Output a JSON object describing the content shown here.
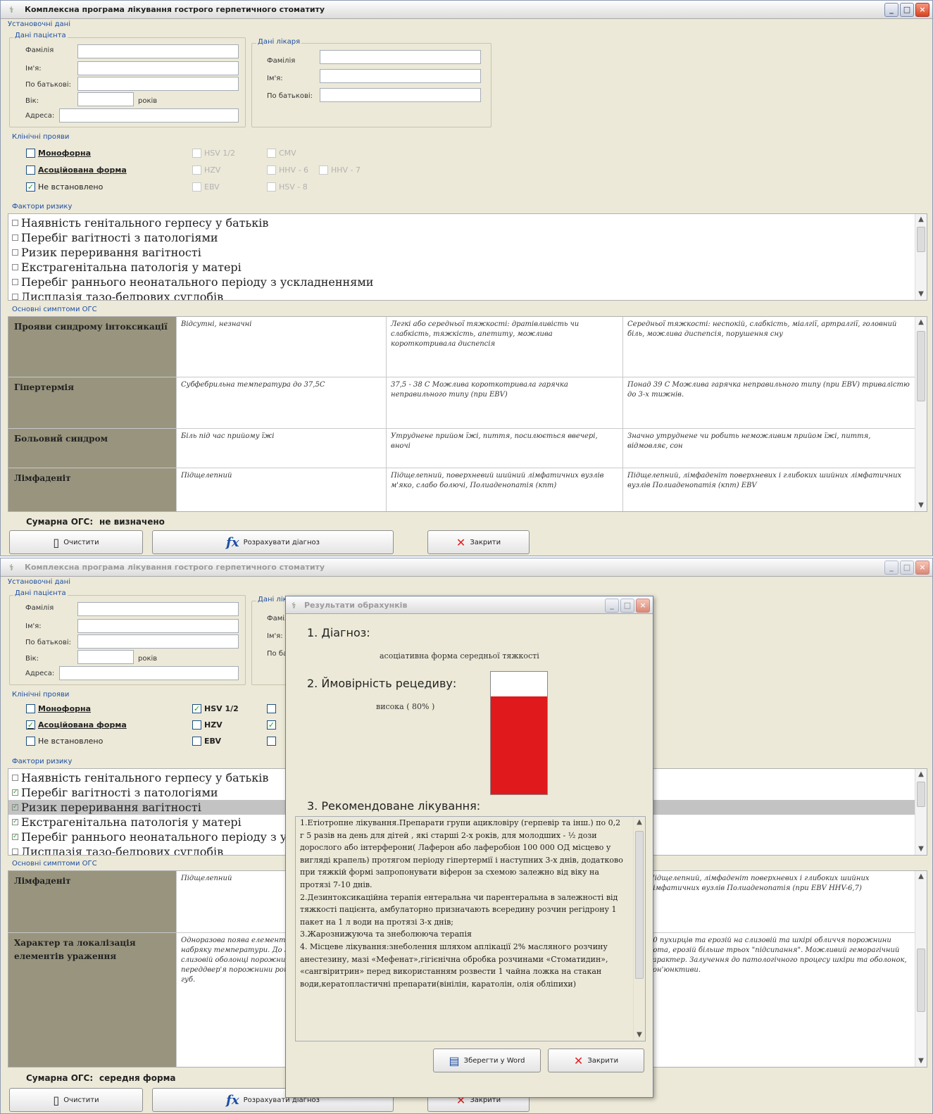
{
  "app": {
    "title": "Комплексна програма лікування гострого герпетичного стоматиту",
    "min_icon": "_",
    "max_icon": "□",
    "close_icon": "×"
  },
  "sections": {
    "settings": "Установочні дані",
    "patient": "Дані пацієнта",
    "doctor": "Дані лікаря",
    "clinical": "Клінічні прояви",
    "risk": "Фактори ризику",
    "symptoms": "Основні симптоми ОГС"
  },
  "labels": {
    "surname": "Фамілія",
    "name": "Ім'я:",
    "patronymic": "По батькові:",
    "age": "Вік:",
    "age_unit": "років",
    "address": "Адреса:",
    "sum": "Сумарна ОГС:"
  },
  "clinical": {
    "mono": "Монофорна",
    "assoc": "Асоційована форма",
    "unset": "Не встановлено",
    "hsv": "HSV 1/2",
    "hzv": "HZV",
    "ebv": "EBV",
    "cmv": "CMV",
    "hhv67": "HHV - 6",
    "hhv7": "HHV - 7",
    "hsv8": "HSV - 8"
  },
  "risk_factors": [
    "Наявність генітального герпесу у батьків",
    "Перебіг вагітності з патологіями",
    "Ризик переривання вагітності",
    "Екстрагенітальна патологія у матері",
    "Перебіг раннього неонатального періоду з ускладненнями",
    "Дисплазія тазо-бедрових суглобів"
  ],
  "screen1": {
    "check_mark": "✓",
    "symptoms": [
      {
        "name": "Прояви синдрому інтоксикації",
        "c1": "Відсутні, незначні",
        "c2": "Легкі або середньої тяжкості: дратівливість чи слабкість, тяжкість, апетиту, можлива короткотривала диспепсія",
        "c3": "Середньої тяжкості: неспокій, слабкість, міалгії, артралгії, головний біль, можлива диспепсія, порушення сну"
      },
      {
        "name": "Гіпертермія",
        "c1": "Субфебрильна температура до 37,5С",
        "c2": "37,5 - 38 С Можлива короткотривала гарячка неправильного типу (при EBV)",
        "c3": "Понад 39 С Можлива гарячка неправильного типу (при EBV) тривалістю до 3-х тижнів."
      },
      {
        "name": "Больовий синдром",
        "c1": "Біль під час прийому їжі",
        "c2": "Утруднене прийом їжі, пиття, посилюється ввечері, вночі",
        "c3": "Значно утруднене чи робить неможливим прийом їжі, пиття, відмовляє, сон"
      },
      {
        "name": "Лімфаденіт",
        "c1": "Підщелепний",
        "c2": "Підщелепний, поверхневий шийний лімфатичних вузлів м'яко, слабо болючі, Полиаденопатія (кпт)",
        "c3": "Підщелепний, лімфаденіт поверхневих і глибоких шийних лімфатичних вузлів Полиаденопатія (кпт) EBV"
      }
    ],
    "sum_value": "не визначено"
  },
  "screen2": {
    "check_mark": "✓",
    "symptoms": [
      {
        "name": "Лімфаденіт",
        "c1": "Підщелепний",
        "c3": "Підщелепний, лімфаденіт поверхневих і глибоких шийних лімфатичних вузлів Полиаденопатія (при EBV HHV-6,7)"
      },
      {
        "name": "Характер та локалізація елементів ураження",
        "c1": "Одноразова поява елементів ураження на фоні набряку температури. До 5 пухирців та ерозій на слизовій оболонці порожнини рота (язика, губ, переддвер'я порожнини рота, щік), червоної кайми губ.",
        "c3": "20 пухирців та ерозій на слизовій та шкірі обличчя порожнини рота, ерозій більше трьох \"підсипання\". Можливий геморагічний характер. Залучення до патологічного процесу шкіри та оболонок, кон'юнктиви."
      }
    ],
    "sum_value": "середня форма"
  },
  "dialog": {
    "title": "Результати обрахунків",
    "diag_h": "1. Діагноз:",
    "diag_v": "асоціативна форма  середньої тяжкості",
    "prob_h": "2. Ймовірність рецедиву:",
    "prob_v": "висока ( 80% )",
    "prob_fraction": 0.8,
    "treat_h": "3. Рекомендоване лікування:",
    "treatment": [
      "1.Етіотропне лікування.Препарати групи ацикловіру (герпевір та інш.) по 0,2 г 5 разів на день для дітей , які старші 2-х років, для молодших - ½ дози дорослого або інтерферони( Лаферон або лаферобіон 100 000 ОД місцево у вигляді крапель) протягом періоду гіпертермії і наступних 3-х днів, додатково при тяжкій формі запропонувати віферон за схемою залежно від віку на протязі 7-10 днів.",
      "2.Дезинтоксикаційна терапія ентеральна чи парентеральна в залежності від тяжкості пацієнта, амбулаторно призначають всередину розчин регідрону 1 пакет на 1 л води на протязі 3-х днів;",
      "3.Жарознижуюча та знеболююча терапія",
      "4. Місцеве лікування:знеболення шляхом аплікації 2% масляного розчину анестезину, мазі «Мефенат»,гігієнічна обробка розчинами «Стоматидин», «сангвіритрин» перед використанням розвести 1 чайна ложка на стакан води,кератопластичні препарати(вінілін, каратолін, олія обліпихи)"
    ],
    "save_btn": "Зберегти у Word",
    "close_btn": "Закрити"
  },
  "buttons": {
    "clear": "Очистити",
    "calc": "Розрахувати діагноз",
    "close": "Закрити"
  },
  "icons": {
    "app": "stethoscope-icon",
    "clear": "document-icon",
    "calc": "fx-icon",
    "close": "close-x-icon",
    "word": "word-document-icon"
  },
  "colors": {
    "accent": "#1d4ea3",
    "gauge": "#e0191c",
    "check": "#21a121",
    "symptom_header": "#98947e"
  }
}
